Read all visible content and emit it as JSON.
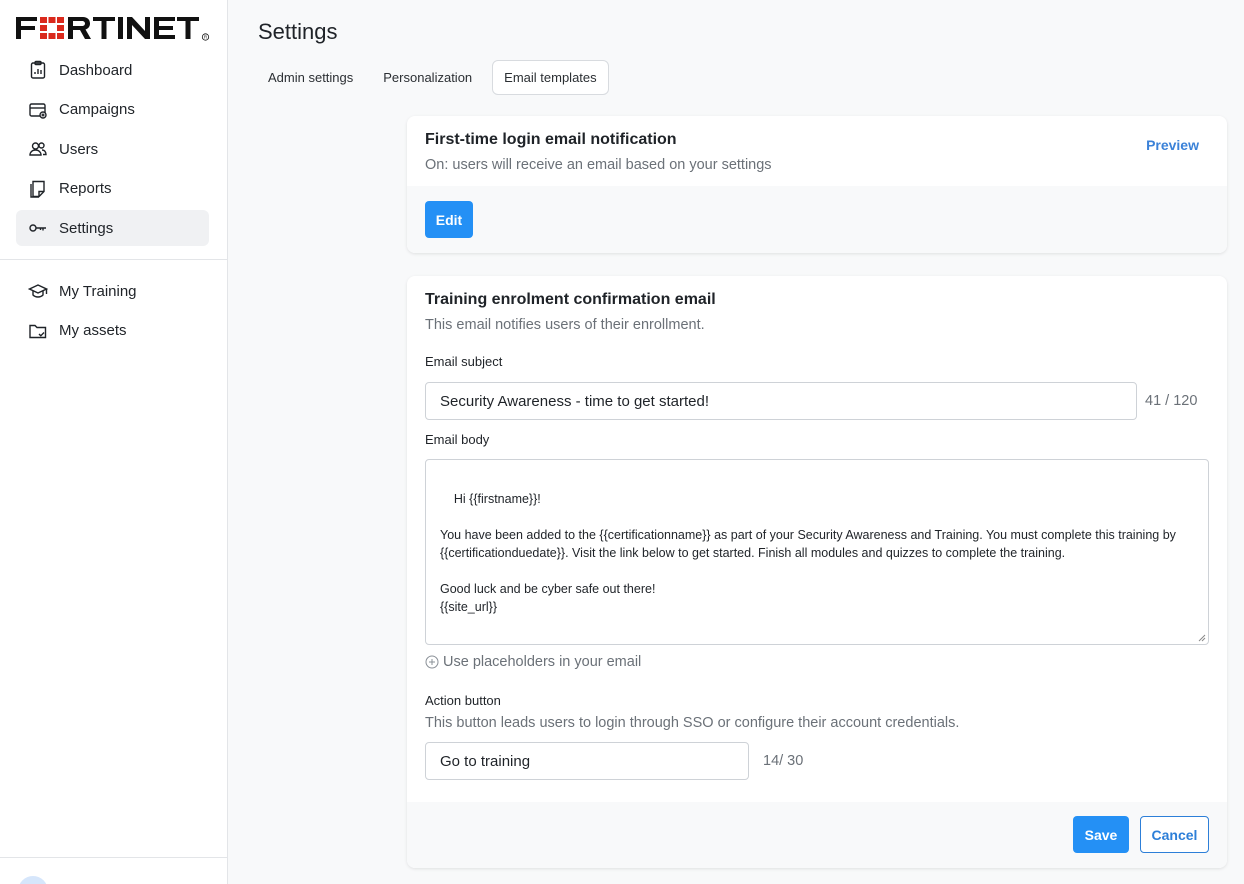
{
  "brand": {
    "name": "FORTINET",
    "color": "#da291c"
  },
  "sidebar": {
    "items": [
      {
        "label": "Dashboard",
        "icon": "dashboard-icon"
      },
      {
        "label": "Campaigns",
        "icon": "campaigns-icon"
      },
      {
        "label": "Users",
        "icon": "users-icon"
      },
      {
        "label": "Reports",
        "icon": "reports-icon"
      },
      {
        "label": "Settings",
        "icon": "key-icon",
        "active": true
      }
    ],
    "secondary_items": [
      {
        "label": "My Training",
        "icon": "graduation-cap-icon"
      },
      {
        "label": "My assets",
        "icon": "folder-icon"
      }
    ]
  },
  "page": {
    "title": "Settings"
  },
  "tabs": [
    {
      "label": "Admin settings",
      "active": false
    },
    {
      "label": "Personalization",
      "active": false
    },
    {
      "label": "Email templates",
      "active": true
    }
  ],
  "first_login_card": {
    "title": "First-time login email notification",
    "subtitle": "On: users will receive an email based on your settings",
    "preview_label": "Preview",
    "edit_label": "Edit"
  },
  "enrolment_card": {
    "title": "Training enrolment confirmation email",
    "subtitle": "This email notifies users of their enrollment.",
    "subject_label": "Email subject",
    "subject_value": "Security Awareness - time to get started!",
    "subject_counter": "41 / 120",
    "body_label": "Email body",
    "body_value": "Hi {{firstname}}!\n\nYou have been added to the {{certificationname}} as part of your Security Awareness and Training. You must complete this training by {{certificationduedate}}. Visit the link below to get started. Finish all modules and quizzes to complete the training.\n\nGood luck and be cyber safe out there!\n{{site_url}}",
    "placeholders_link": "Use placeholders in your email",
    "action_label": "Action button",
    "action_subtitle": "This button leads users to login through SSO or configure their account credentials.",
    "action_value": "Go to training",
    "action_counter": "14/ 30",
    "save_label": "Save",
    "cancel_label": "Cancel"
  },
  "colors": {
    "accent": "#2490f5",
    "link": "#3b82d8",
    "active_nav_bg": "#f0f1f3"
  }
}
